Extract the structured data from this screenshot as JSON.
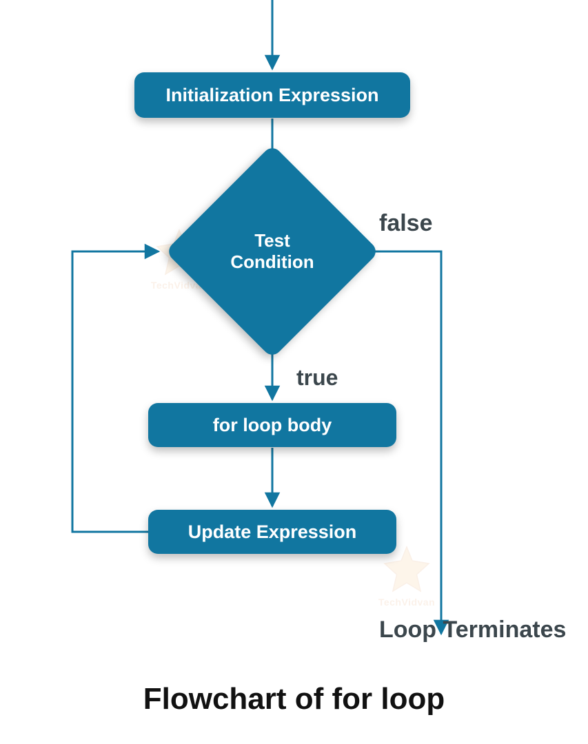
{
  "diagram": {
    "title": "Flowchart of for loop",
    "nodes": {
      "init": {
        "label": "Initialization Expression"
      },
      "test": {
        "label": "Test\nCondition"
      },
      "body": {
        "label": "for loop body"
      },
      "update": {
        "label": "Update Expression"
      }
    },
    "edges": {
      "true_label": "true",
      "false_label": "false",
      "terminate_label": "Loop Terminates"
    },
    "watermark": "TechVidvan",
    "colors": {
      "node_fill": "#1176a0",
      "node_text": "#ffffff",
      "line": "#1176a0",
      "label": "#3b464c"
    }
  }
}
